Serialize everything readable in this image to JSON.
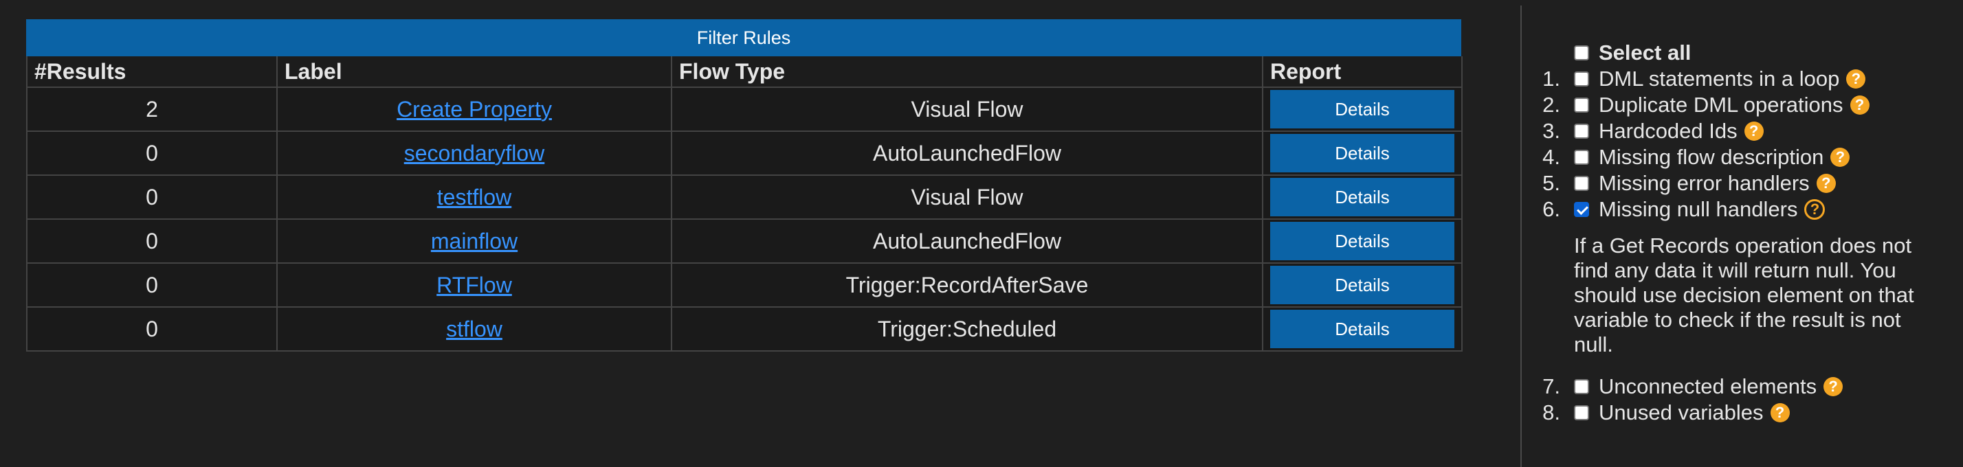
{
  "filter_button": {
    "label": "Filter Rules"
  },
  "table": {
    "headers": [
      "#Results",
      "Label",
      "Flow Type",
      "Report"
    ],
    "rows": [
      {
        "results": "2",
        "label": "Create Property",
        "flow_type": "Visual Flow",
        "report": "Details"
      },
      {
        "results": "0",
        "label": "secondaryflow",
        "flow_type": "AutoLaunchedFlow",
        "report": "Details"
      },
      {
        "results": "0",
        "label": "testflow",
        "flow_type": "Visual Flow",
        "report": "Details"
      },
      {
        "results": "0",
        "label": "mainflow",
        "flow_type": "AutoLaunchedFlow",
        "report": "Details"
      },
      {
        "results": "0",
        "label": "RTFlow",
        "flow_type": "Trigger:RecordAfterSave",
        "report": "Details"
      },
      {
        "results": "0",
        "label": "stflow",
        "flow_type": "Trigger:Scheduled",
        "report": "Details"
      }
    ]
  },
  "rules_panel": {
    "select_all_label": "Select all",
    "select_all_checked": false,
    "rules": [
      {
        "number": "1.",
        "label": "DML statements in a loop",
        "checked": false,
        "help_icon": "help-icon"
      },
      {
        "number": "2.",
        "label": "Duplicate DML operations",
        "checked": false,
        "help_icon": "help-icon"
      },
      {
        "number": "3.",
        "label": "Hardcoded Ids",
        "checked": false,
        "help_icon": "help-icon"
      },
      {
        "number": "4.",
        "label": "Missing flow description",
        "checked": false,
        "help_icon": "help-icon"
      },
      {
        "number": "5.",
        "label": "Missing error handlers",
        "checked": false,
        "help_icon": "help-icon"
      },
      {
        "number": "6.",
        "label": "Missing null handlers",
        "checked": true,
        "help_icon": "help-icon-active",
        "description": "If a Get Records operation does not find any data it will return null. You should use decision element on that variable to check if the result is not null."
      },
      {
        "number": "7.",
        "label": "Unconnected elements",
        "checked": false,
        "help_icon": "help-icon"
      },
      {
        "number": "8.",
        "label": "Unused variables",
        "checked": false,
        "help_icon": "help-icon"
      }
    ],
    "help_glyph": "?"
  },
  "colors": {
    "background": "#1f1f1f",
    "accent_button": "#0b63a6",
    "link": "#3794ff",
    "help_badge": "#f5a623",
    "checkbox_checked": "#0b63d6"
  }
}
